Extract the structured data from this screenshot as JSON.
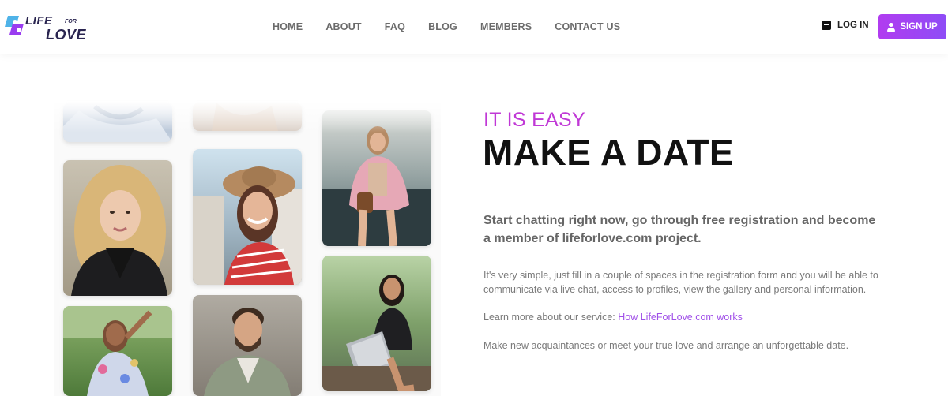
{
  "brand": {
    "logo_life": "LIFE",
    "logo_for": "FOR",
    "logo_love": "LOVE"
  },
  "nav": {
    "items": [
      "HOME",
      "ABOUT",
      "FAQ",
      "BLOG",
      "MEMBERS",
      "CONTACT US"
    ]
  },
  "auth": {
    "login_label": "LOG IN",
    "signup_label": "SIGN UP"
  },
  "colors": {
    "accent": "#c038d6",
    "signup_gradient_start": "#b13cf0",
    "signup_gradient_end": "#8e4cf6",
    "link": "#a04fe8"
  },
  "hero": {
    "eyebrow": "IT IS EASY",
    "headline": "MAKE A DATE",
    "lead": "Start chatting right now, go through free registration and become a member of lifeforlove.com project.",
    "paragraph1": "It's very simple, just fill in a couple of spaces in the registration form and you will be able to communicate via live chat, access to profiles, view the gallery and personal information.",
    "paragraph2_prefix": "Learn more about our service: ",
    "paragraph2_link": "How LifeForLove.com works",
    "paragraph3": "Make new acquaintances or meet your true love and arrange an unforgettable date."
  },
  "photos": [
    {
      "name": "profile-photo-1",
      "desc": "woman top cropped"
    },
    {
      "name": "profile-photo-2",
      "desc": "woman top cropped"
    },
    {
      "name": "profile-photo-3",
      "desc": "woman in pink jacket"
    },
    {
      "name": "profile-photo-4",
      "desc": "blonde woman"
    },
    {
      "name": "profile-photo-5",
      "desc": "woman in hat"
    },
    {
      "name": "profile-photo-6",
      "desc": "woman with laptop"
    },
    {
      "name": "profile-photo-7",
      "desc": "woman in floral dress"
    },
    {
      "name": "profile-photo-8",
      "desc": "bearded man"
    }
  ]
}
